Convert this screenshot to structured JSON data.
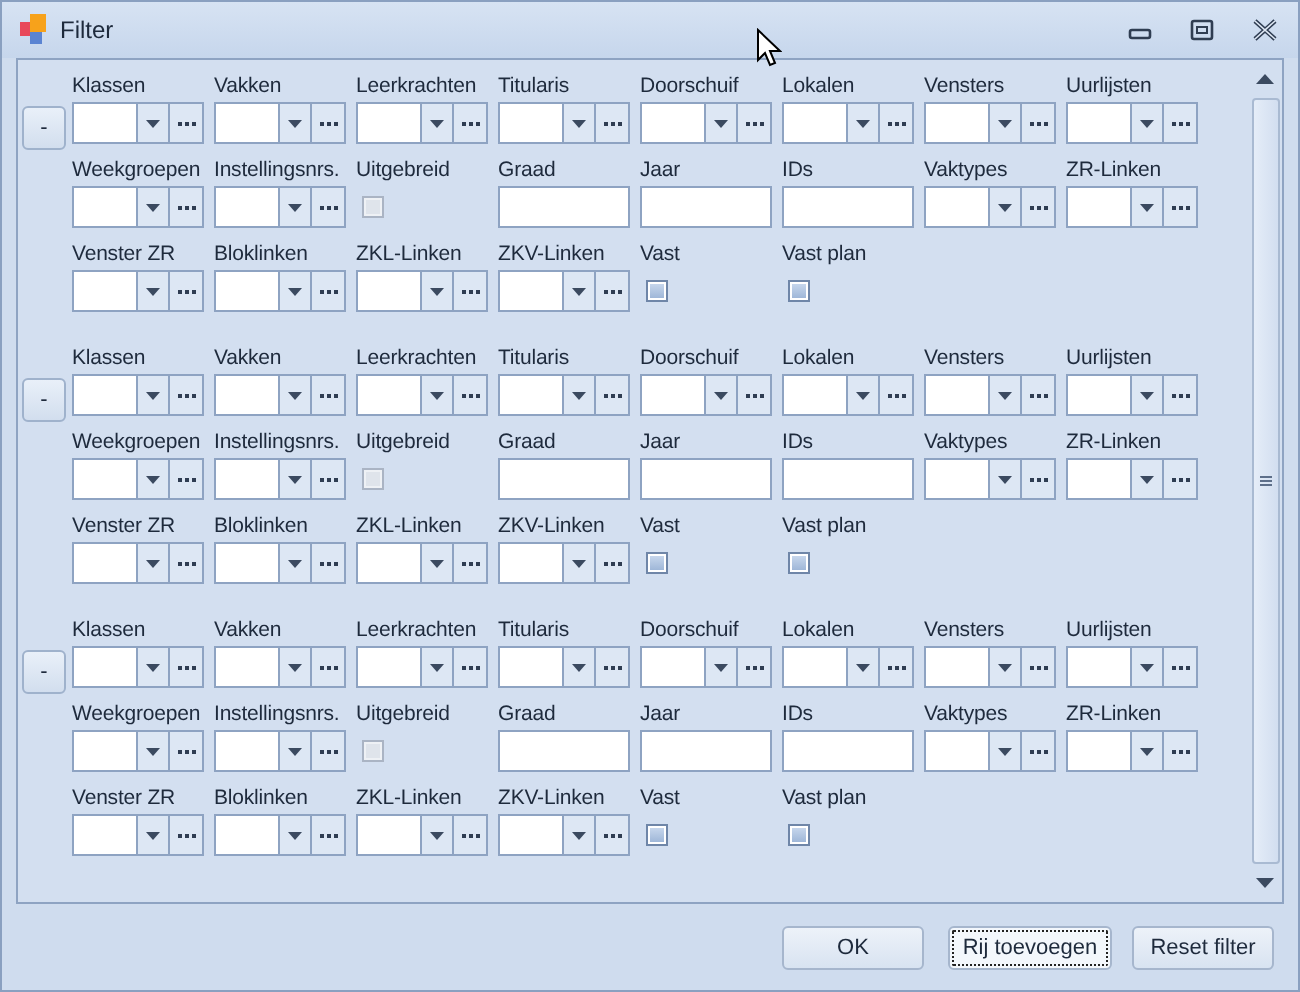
{
  "window": {
    "title": "Filter"
  },
  "groups": [
    {
      "remove_button": "-",
      "fields": [
        {
          "label": "Klassen",
          "kind": "combo"
        },
        {
          "label": "Vakken",
          "kind": "combo"
        },
        {
          "label": "Leerkrachten",
          "kind": "combo"
        },
        {
          "label": "Titularis",
          "kind": "combo"
        },
        {
          "label": "Doorschuif",
          "kind": "combo"
        },
        {
          "label": "Lokalen",
          "kind": "combo"
        },
        {
          "label": "Vensters",
          "kind": "combo"
        },
        {
          "label": "Uurlijsten",
          "kind": "combo"
        },
        {
          "label": "Weekgroepen",
          "kind": "combo"
        },
        {
          "label": "Instellingsnrs.",
          "kind": "combo"
        },
        {
          "label": "Uitgebreid",
          "kind": "checkbox",
          "checked": false,
          "disabled": true
        },
        {
          "label": "Graad",
          "kind": "text"
        },
        {
          "label": "Jaar",
          "kind": "text"
        },
        {
          "label": "IDs",
          "kind": "text"
        },
        {
          "label": "Vaktypes",
          "kind": "combo"
        },
        {
          "label": "ZR-Linken",
          "kind": "combo"
        },
        {
          "label": "Venster ZR",
          "kind": "combo"
        },
        {
          "label": "Bloklinken",
          "kind": "combo"
        },
        {
          "label": "ZKL-Linken",
          "kind": "combo"
        },
        {
          "label": "ZKV-Linken",
          "kind": "combo"
        },
        {
          "label": "Vast",
          "kind": "checkbox",
          "checked": false,
          "disabled": false
        },
        {
          "label": "Vast plan",
          "kind": "checkbox",
          "checked": false,
          "disabled": false
        }
      ]
    },
    {
      "remove_button": "-",
      "fields": [
        {
          "label": "Klassen",
          "kind": "combo"
        },
        {
          "label": "Vakken",
          "kind": "combo"
        },
        {
          "label": "Leerkrachten",
          "kind": "combo"
        },
        {
          "label": "Titularis",
          "kind": "combo"
        },
        {
          "label": "Doorschuif",
          "kind": "combo"
        },
        {
          "label": "Lokalen",
          "kind": "combo"
        },
        {
          "label": "Vensters",
          "kind": "combo"
        },
        {
          "label": "Uurlijsten",
          "kind": "combo"
        },
        {
          "label": "Weekgroepen",
          "kind": "combo"
        },
        {
          "label": "Instellingsnrs.",
          "kind": "combo"
        },
        {
          "label": "Uitgebreid",
          "kind": "checkbox",
          "checked": false,
          "disabled": true
        },
        {
          "label": "Graad",
          "kind": "text"
        },
        {
          "label": "Jaar",
          "kind": "text"
        },
        {
          "label": "IDs",
          "kind": "text"
        },
        {
          "label": "Vaktypes",
          "kind": "combo"
        },
        {
          "label": "ZR-Linken",
          "kind": "combo"
        },
        {
          "label": "Venster ZR",
          "kind": "combo"
        },
        {
          "label": "Bloklinken",
          "kind": "combo"
        },
        {
          "label": "ZKL-Linken",
          "kind": "combo"
        },
        {
          "label": "ZKV-Linken",
          "kind": "combo"
        },
        {
          "label": "Vast",
          "kind": "checkbox",
          "checked": false,
          "disabled": false
        },
        {
          "label": "Vast plan",
          "kind": "checkbox",
          "checked": false,
          "disabled": false
        }
      ]
    },
    {
      "remove_button": "-",
      "fields": [
        {
          "label": "Klassen",
          "kind": "combo"
        },
        {
          "label": "Vakken",
          "kind": "combo"
        },
        {
          "label": "Leerkrachten",
          "kind": "combo"
        },
        {
          "label": "Titularis",
          "kind": "combo"
        },
        {
          "label": "Doorschuif",
          "kind": "combo"
        },
        {
          "label": "Lokalen",
          "kind": "combo"
        },
        {
          "label": "Vensters",
          "kind": "combo"
        },
        {
          "label": "Uurlijsten",
          "kind": "combo"
        },
        {
          "label": "Weekgroepen",
          "kind": "combo"
        },
        {
          "label": "Instellingsnrs.",
          "kind": "combo"
        },
        {
          "label": "Uitgebreid",
          "kind": "checkbox",
          "checked": false,
          "disabled": true
        },
        {
          "label": "Graad",
          "kind": "text"
        },
        {
          "label": "Jaar",
          "kind": "text"
        },
        {
          "label": "IDs",
          "kind": "text"
        },
        {
          "label": "Vaktypes",
          "kind": "combo"
        },
        {
          "label": "ZR-Linken",
          "kind": "combo"
        },
        {
          "label": "Venster ZR",
          "kind": "combo"
        },
        {
          "label": "Bloklinken",
          "kind": "combo"
        },
        {
          "label": "ZKL-Linken",
          "kind": "combo"
        },
        {
          "label": "ZKV-Linken",
          "kind": "combo"
        },
        {
          "label": "Vast",
          "kind": "checkbox",
          "checked": false,
          "disabled": false
        },
        {
          "label": "Vast plan",
          "kind": "checkbox",
          "checked": false,
          "disabled": false
        }
      ]
    }
  ],
  "buttons": [
    {
      "label": "OK",
      "focused": false
    },
    {
      "label": "Rij toevoegen",
      "focused": true
    },
    {
      "label": "Reset filter",
      "focused": false
    }
  ]
}
